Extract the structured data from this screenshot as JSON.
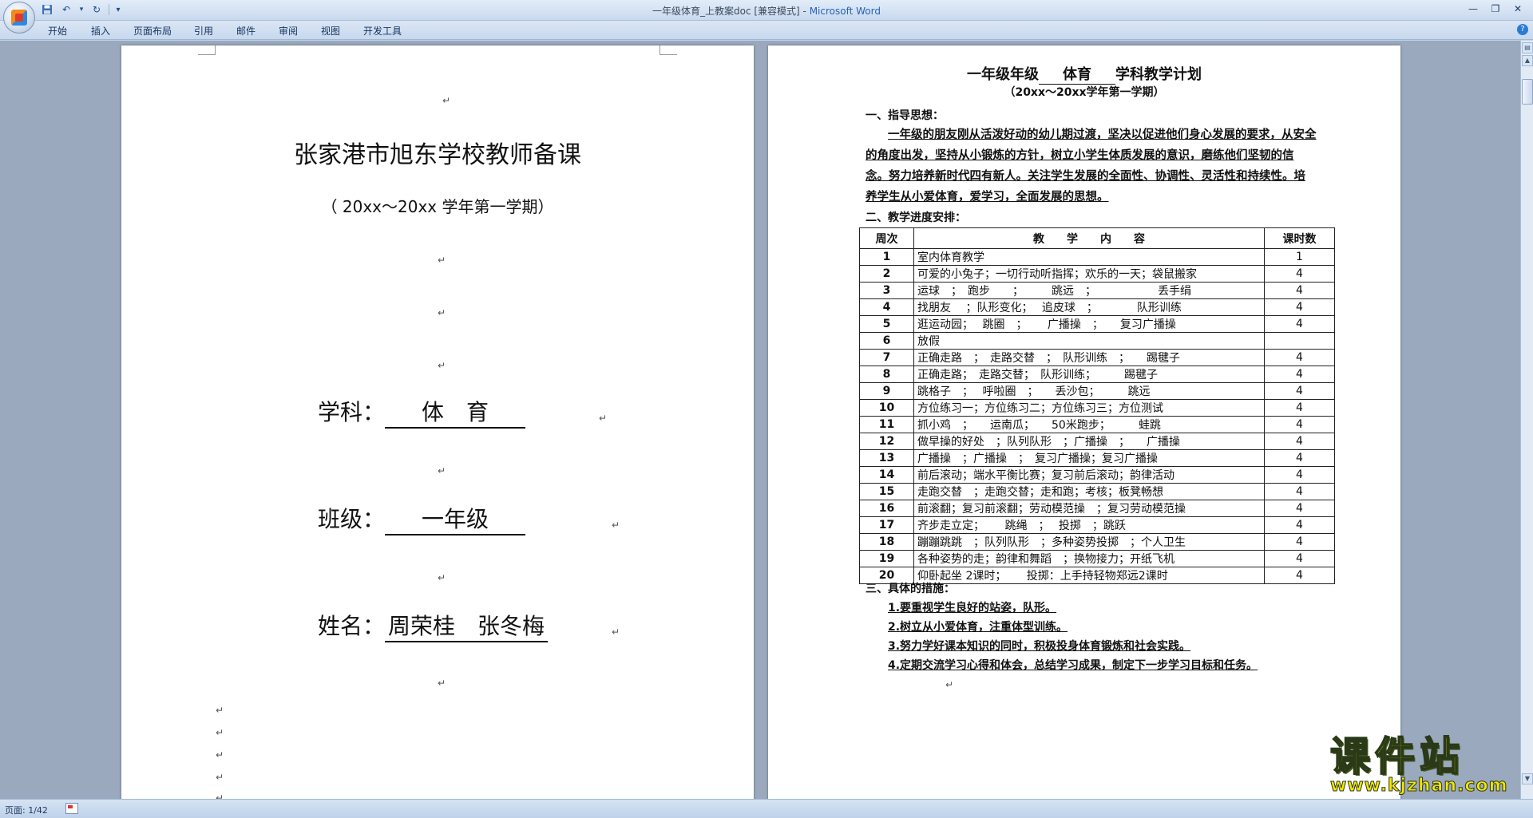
{
  "window": {
    "title": "一年级体育_上教案doc [兼容模式] - ",
    "app_name": "Microsoft Word"
  },
  "quick_access": {
    "dropdown": "▾"
  },
  "ribbon_tabs": [
    "开始",
    "插入",
    "页面布局",
    "引用",
    "邮件",
    "审阅",
    "视图",
    "开发工具"
  ],
  "left_page": {
    "title": "张家港市旭东学校教师备课",
    "subtitle": "（ 20xx～20xx 学年第一学期）",
    "subject_label": "学科：",
    "subject_value": "体　育",
    "class_label": "班级：",
    "class_value": "一年级",
    "name_label": "姓名：",
    "name_value": "周荣桂　张冬梅"
  },
  "right_page": {
    "title_pre": "一年级年级",
    "title_subject": "体育",
    "title_post": "学科教学计划",
    "subtitle": "（20xx～20xx学年第一学期）",
    "section1": "一、指导思想：",
    "para1": "一年级的朋友刚从活泼好动的幼儿期过渡，坚决以促进他们身心发展的要求，从安全的角度出发，坚持从小锻炼的方针，树立小学生体质发展的意识，磨练他们坚韧的信念。努力培养新时代四有新人。关注学生发展的全面性、协调性、灵活性和持续性。培养学生从小爱体育，爱学习，全面发展的思想。",
    "section2": "二、教学进度安排：",
    "table_headers": [
      "周次",
      "教　　学　　内　　容",
      "课时数"
    ],
    "rows": [
      {
        "week": "1",
        "content": "室内体育教学",
        "hours": "1"
      },
      {
        "week": "2",
        "content": "可爱的小兔子；一切行动听指挥；欢乐的一天；袋鼠搬家",
        "hours": "4"
      },
      {
        "week": "3",
        "content": "运球　；　跑步　　；　　　跳远　；　　　　　　丢手绢",
        "hours": "4"
      },
      {
        "week": "4",
        "content": " 找朋友　 ；队形变化；　 追皮球　；　　　　队形训练",
        "hours": "4"
      },
      {
        "week": "5",
        "content": "逛运动园；　 跳圈　；　　 广播操　；　　复习广播操",
        "hours": "4"
      },
      {
        "week": "6",
        "content": "放假",
        "hours": ""
      },
      {
        "week": "7",
        "content": "正确走路　；　走路交替　；　队形训练　；　　踢毽子",
        "hours": "4"
      },
      {
        "week": "8",
        "content": "正确走路；　走路交替；　队形训练；　　　踢毽子",
        "hours": "4"
      },
      {
        "week": "9",
        "content": "跳格子　；　 呼啦圈　；　　丢沙包；　　　跳远",
        "hours": "4"
      },
      {
        "week": "10",
        "content": "方位练习一；方位练习二；方位练习三；方位测试",
        "hours": "4"
      },
      {
        "week": "11",
        "content": "  抓小鸡　；　　运南瓜；　　50米跑步；　　　蛙跳",
        "hours": "4"
      },
      {
        "week": "12",
        "content": "做早操的好处　；队列队形　；广播操　；　　广播操",
        "hours": "4"
      },
      {
        "week": "13",
        "content": "广播操　；广播操　；　复习广播操；复习广播操",
        "hours": "4"
      },
      {
        "week": "14",
        "content": "前后滚动；端水平衡比赛；复习前后滚动；韵律活动",
        "hours": "4"
      },
      {
        "week": "15",
        "content": "  走跑交替　；走跑交替；走和跑；考核；板凳畅想",
        "hours": "4"
      },
      {
        "week": "16",
        "content": "前滚翻；复习前滚翻；劳动模范操　；复习劳动模范操",
        "hours": "4"
      },
      {
        "week": "17",
        "content": "齐步走立定；　　 跳绳　；　 投掷　；跳跃",
        "hours": "4"
      },
      {
        "week": "18",
        "content": "蹦蹦跳跳　；队列队形　；多种姿势投掷　；个人卫生",
        "hours": "4"
      },
      {
        "week": "19",
        "content": "各种姿势的走；韵律和舞蹈　；换物接力；开纸飞机",
        "hours": "4"
      },
      {
        "week": "20",
        "content": "仰卧起坐 2课时；　　 投掷：上手持轻物郑远2课时",
        "hours": "4"
      }
    ],
    "section3": "三、具体的措施：",
    "measures": [
      "1.要重视学生良好的站姿，队形。",
      "2.树立从小爱体育，注重体型训练。",
      "3.努力学好课本知识的同时，积极投身体育锻炼和社会实践。",
      "4.定期交流学习心得和体会，总结学习成果，制定下一步学习目标和任务。"
    ]
  },
  "watermark": {
    "text": "课件站",
    "url": "www.kjzhan.com"
  },
  "status_bar": {
    "page": "页面: 1/42"
  }
}
